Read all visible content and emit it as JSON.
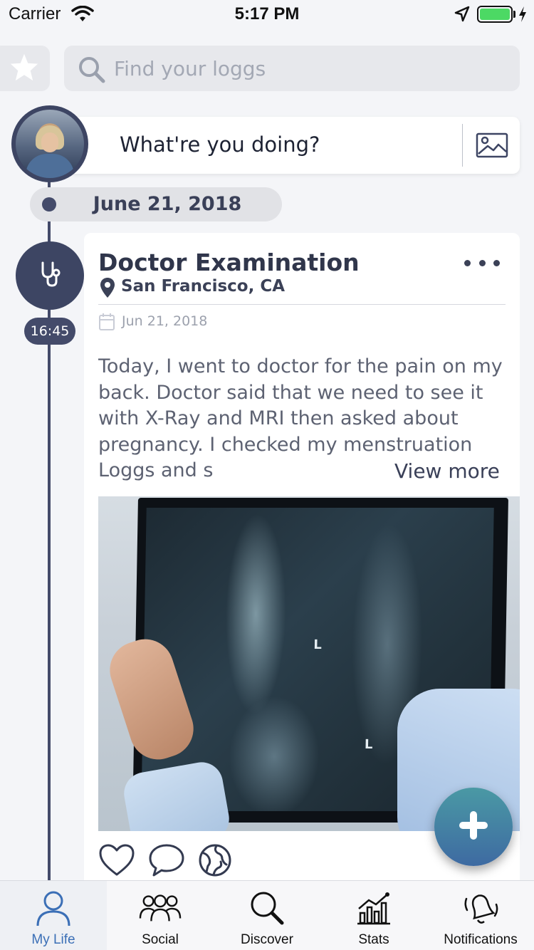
{
  "status_bar": {
    "carrier": "Carrier",
    "time": "5:17 PM",
    "battery_color": "#4cd964"
  },
  "search": {
    "placeholder": "Find your loggs",
    "favorites_icon": "star-icon"
  },
  "compose": {
    "prompt": "What're you doing?",
    "image_icon": "image-icon"
  },
  "timeline": {
    "date_header": "June 21, 2018"
  },
  "post": {
    "time": "16:45",
    "category_icon": "stethoscope-icon",
    "title": "Doctor Examination",
    "location": "San Francisco, CA",
    "date": "Jun 21, 2018",
    "body": "Today, I went to doctor for the pain on my back. Doctor said that we need to see it with X-Ray and MRI then asked about pregnancy. I checked my menstruation Loggs and s",
    "view_more": "View more",
    "image_letters": [
      "L",
      "L"
    ],
    "actions": [
      "heart-icon",
      "comment-icon",
      "globe-icon"
    ]
  },
  "fab": {
    "icon": "plus-icon"
  },
  "tab_bar": {
    "active": "My Life",
    "items": [
      {
        "label": "My Life",
        "icon": "person-icon"
      },
      {
        "label": "Social",
        "icon": "group-icon"
      },
      {
        "label": "Discover",
        "icon": "magnifier-icon"
      },
      {
        "label": "Stats",
        "icon": "stats-icon"
      },
      {
        "label": "Notifications",
        "icon": "bell-icon"
      }
    ]
  },
  "colors": {
    "accent": "#3d4563",
    "active_tab": "#3b6fb6",
    "fab_top": "#4a99a4",
    "fab_bottom": "#3e6aa2"
  }
}
